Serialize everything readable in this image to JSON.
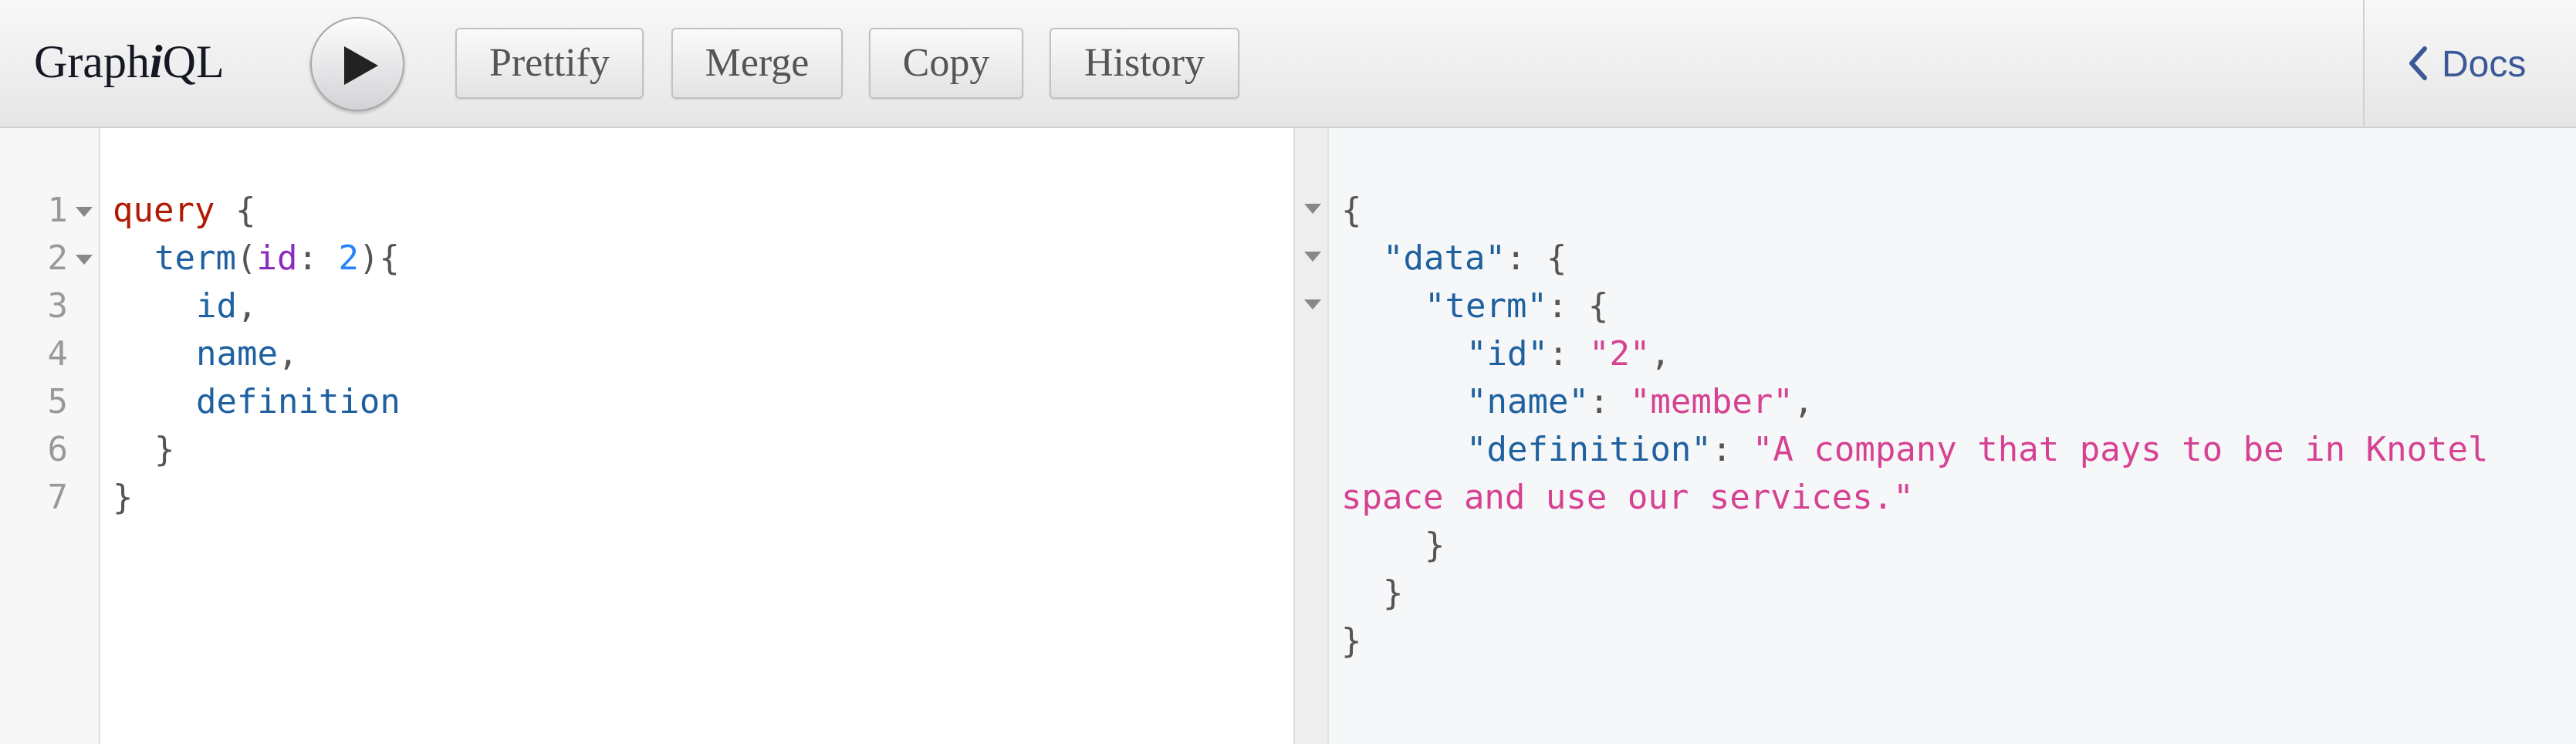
{
  "header": {
    "logo_prefix": "Graph",
    "logo_i": "i",
    "logo_suffix": "QL",
    "run_icon": "play-icon",
    "buttons": {
      "prettify": "Prettify",
      "merge": "Merge",
      "copy": "Copy",
      "history": "History"
    },
    "docs_label": "Docs",
    "docs_icon": "chevron-left-icon"
  },
  "query_editor": {
    "line_numbers": [
      "1",
      "2",
      "3",
      "4",
      "5",
      "6",
      "7"
    ],
    "tokens": {
      "l1_keyword": "query",
      "l1_brace": " {",
      "l2_field": "term",
      "l2_paren_open": "(",
      "l2_arg": "id",
      "l2_colon": ": ",
      "l2_number": "2",
      "l2_paren_close": "){",
      "l3_field": "id",
      "l3_comma": ",",
      "l4_field": "name",
      "l4_comma": ",",
      "l5_field": "definition",
      "l6_brace": "}",
      "l7_brace": "}"
    }
  },
  "result": {
    "tokens": {
      "r1_brace": "{",
      "r2_key": "\"data\"",
      "r2_punct": ": {",
      "r3_key": "\"term\"",
      "r3_punct": ": {",
      "r4_key": "\"id\"",
      "r4_colon": ": ",
      "r4_value": "\"2\"",
      "r4_comma": ",",
      "r5_key": "\"name\"",
      "r5_colon": ": ",
      "r5_value": "\"member\"",
      "r5_comma": ",",
      "r6_key": "\"definition\"",
      "r6_colon": ": ",
      "r6_value_part1": "\"A company that pays to be in Knotel",
      "r7_value_part2": "space and use our services.\"",
      "r8_brace": "}",
      "r9_brace": "}",
      "r10_brace": "}"
    }
  },
  "colors": {
    "keyword": "#b11a04",
    "field": "#1f61a0",
    "argument": "#8b2bb9",
    "number": "#2882f9",
    "string": "#d64292",
    "docs_link": "#3b5998"
  }
}
